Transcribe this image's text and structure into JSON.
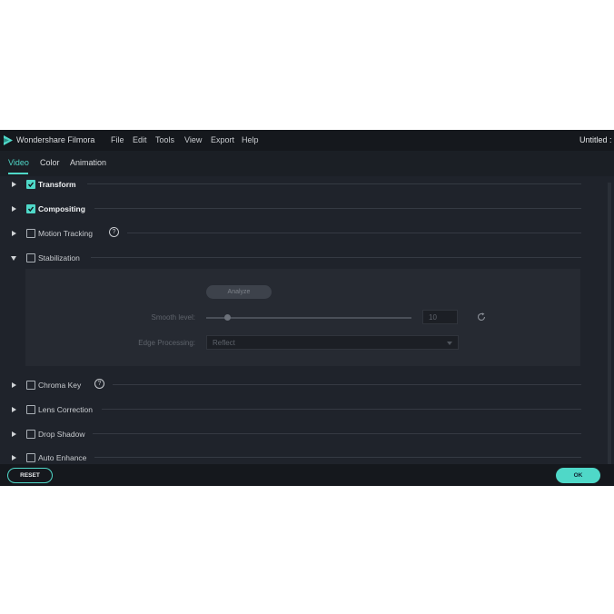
{
  "app": {
    "name": "Wondershare Filmora",
    "document_title": "Untitled :",
    "menu": [
      "File",
      "Edit",
      "Tools",
      "View",
      "Export",
      "Help"
    ],
    "accent_color": "#4fd8c8"
  },
  "tabs": [
    {
      "label": "Video",
      "active": true
    },
    {
      "label": "Color",
      "active": false
    },
    {
      "label": "Animation",
      "active": false
    }
  ],
  "sections": [
    {
      "label": "Transform",
      "checked": true,
      "expanded": false
    },
    {
      "label": "Compositing",
      "checked": true,
      "expanded": false
    },
    {
      "label": "Motion Tracking",
      "checked": false,
      "expanded": false,
      "help": "?"
    },
    {
      "label": "Stabilization",
      "checked": false,
      "expanded": true
    },
    {
      "label": "Chroma Key",
      "checked": false,
      "expanded": false,
      "help": "?"
    },
    {
      "label": "Lens Correction",
      "checked": false,
      "expanded": false
    },
    {
      "label": "Drop Shadow",
      "checked": false,
      "expanded": false
    },
    {
      "label": "Auto Enhance",
      "checked": false,
      "expanded": false
    }
  ],
  "stabilization": {
    "analyze_label": "Analyze",
    "smooth_level_label": "Smooth level:",
    "smooth_level_value": "10",
    "edge_processing_label": "Edge Processing:",
    "edge_processing_value": "Reflect"
  },
  "footer": {
    "reset_label": "RESET",
    "ok_label": "OK"
  }
}
